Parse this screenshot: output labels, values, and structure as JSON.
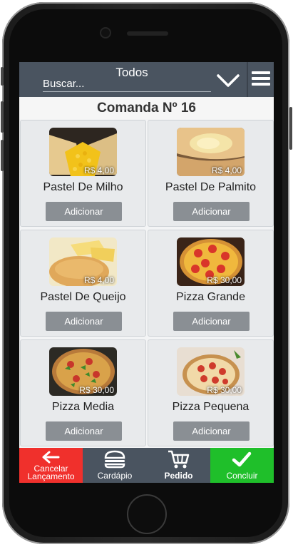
{
  "header": {
    "category": "Todos",
    "search_placeholder": "Buscar..."
  },
  "order": {
    "title": "Comanda Nº 16"
  },
  "products": [
    {
      "name": "Pastel De Milho",
      "price": "R$ 4,00",
      "button": "Adicionar",
      "thumb": "pastel-milho"
    },
    {
      "name": "Pastel De Palmito",
      "price": "R$ 4,00",
      "button": "Adicionar",
      "thumb": "pastel-palmito"
    },
    {
      "name": "Pastel De Queijo",
      "price": "R$ 4,00",
      "button": "Adicionar",
      "thumb": "pastel-queijo"
    },
    {
      "name": "Pizza Grande",
      "price": "R$ 30,00",
      "button": "Adicionar",
      "thumb": "pizza-grande"
    },
    {
      "name": "Pizza Media",
      "price": "R$ 30,00",
      "button": "Adicionar",
      "thumb": "pizza-media"
    },
    {
      "name": "Pizza Pequena",
      "price": "R$ 30,00",
      "button": "Adicionar",
      "thumb": "pizza-pequena"
    }
  ],
  "bottom_nav": {
    "cancel": {
      "label_line1": "Cancelar",
      "label_line2": "Lançamento",
      "icon": "arrow-left-icon",
      "color": "#f0302c"
    },
    "menu": {
      "label": "Cardápio",
      "icon": "burger-icon",
      "color": "#4a5460"
    },
    "order": {
      "label": "Pedido",
      "icon": "cart-icon",
      "color": "#4a5460"
    },
    "finish": {
      "label": "Concluir",
      "icon": "check-icon",
      "color": "#1fbf2a"
    }
  },
  "colors": {
    "header_bg": "#4a5460",
    "card_bg": "#e8eaec",
    "add_button": "#8a8f94"
  }
}
